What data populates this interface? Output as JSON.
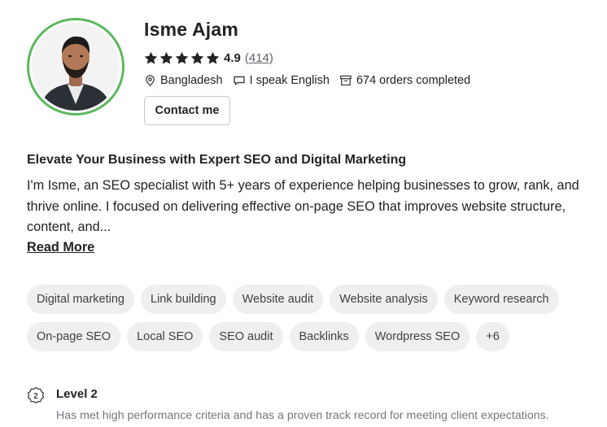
{
  "profile": {
    "name": "Isme Ajam",
    "rating": "4.9",
    "rating_count": "(414)",
    "stars": 5,
    "location": "Bangladesh",
    "languages": "I speak English",
    "orders": "674 orders completed",
    "contact_label": "Contact me"
  },
  "about": {
    "headline": "Elevate Your Business with Expert SEO and Digital Marketing",
    "bio": "I'm Isme, an SEO specialist with 5+ years of experience helping businesses to grow, rank, and thrive online. I focused on delivering effective on-page SEO that improves website structure, content, and...",
    "read_more": "Read More"
  },
  "skills": [
    "Digital marketing",
    "Link building",
    "Website audit",
    "Website analysis",
    "Keyword research",
    "On-page SEO",
    "Local SEO",
    "SEO audit",
    "Backlinks",
    "Wordpress SEO",
    "+6"
  ],
  "level": {
    "badge_number": "2",
    "title": "Level 2",
    "description": "Has met high performance criteria and has a proven track record for meeting client expectations."
  },
  "colors": {
    "avatar_ring": "#5cb85c",
    "text_primary": "#222325",
    "text_secondary": "#74767e",
    "chip_bg": "#efeff0"
  },
  "icons": [
    "star-icon",
    "location-pin-icon",
    "chat-bubble-icon",
    "archive-box-icon",
    "level-badge-icon"
  ]
}
